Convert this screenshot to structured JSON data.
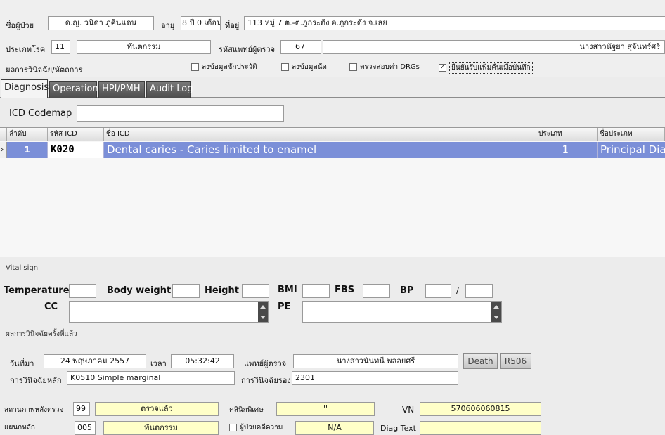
{
  "patient": {
    "name_label": "ชื่อผู้ป่วย",
    "name": "ด.ญ. วนิดา ภูคินแดน",
    "age_label": "อายุ",
    "age": "8 ปี 0 เดือน",
    "address_label": "ที่อยู่",
    "address": "113 หมู่ 7 ต.-ต.ภูกระดึง อ.ภูกระดึง จ.เลย",
    "disease_type_label": "ประเภทโรค",
    "disease_type_code": "11",
    "disease_type_name": "ทันตกรรม",
    "doctor_code_label": "รหัสแพทย์ผู้ตรวจ",
    "doctor_code": "67",
    "doctor_name": "นางสาวนัฐยา สุจันทร์ศรี",
    "result_label": "ผลการวินิจฉัย/หัตถการ"
  },
  "checkboxes": [
    {
      "label": "ลงข้อมูลซักประวัติ",
      "checked": false
    },
    {
      "label": "ลงข้อมูลนัด",
      "checked": false
    },
    {
      "label": "ตรวจสอบค่า DRGs",
      "checked": false
    },
    {
      "label": "ยืนยันรับแฟ้มคืนเมื่อบันทึก",
      "checked": true
    }
  ],
  "tabs": [
    "Diagnosis",
    "Operation",
    "HPI/PMH",
    "Audit Log"
  ],
  "icd_codemap": {
    "label": "ICD Codemap",
    "value": ""
  },
  "grid": {
    "columns": [
      "ลำดับ",
      "รหัส ICD",
      "ชื่อ ICD",
      "ประเภท",
      "ชื่อประเภท"
    ],
    "rows": [
      {
        "no": "1",
        "code": "K020",
        "name": "Dental caries - Caries limited to enamel",
        "type": "1",
        "type_name": "Principal Diag"
      }
    ]
  },
  "vital": {
    "section_label": "Vital sign",
    "temperature_label": "Temperature",
    "weight_label": "Body weight",
    "height_label": "Height",
    "bmi_label": "BMI",
    "fbs_label": "FBS",
    "bp_label": "BP",
    "bp_sep": "/",
    "cc_label": "CC",
    "pe_label": "PE"
  },
  "previous": {
    "section_label": "ผลการวินิจฉัยครั้งที่แล้ว",
    "date_label": "วันที่มา",
    "date": "24 พฤษภาคม 2557",
    "time_label": "เวลา",
    "time": "05:32:42",
    "doctor_label": "แพทย์ผู้ตรวจ",
    "doctor": "นางสาวนันทนี พลอยศรี",
    "death_button": "Death",
    "r506_button": "R506",
    "main_dx_label": "การวินิจฉัยหลัก",
    "main_dx": "K0510 Simple marginal",
    "sub_dx_label": "การวินิจฉัยรอง",
    "sub_dx": "2301"
  },
  "footer": {
    "status_label": "สถานภาพหลังตรวจ",
    "status_code": "99",
    "status_name": "ตรวจแล้ว",
    "clinic_label": "คลินิกพิเศษ",
    "clinic_value": "\"\"",
    "vn_label": "VN",
    "vn_value": "570606060815",
    "dept_label": "แผนกหลัก",
    "dept_code": "005",
    "dept_name": "ทันตกรรม",
    "sick_label": "ผู้ป่วยคดีความ",
    "sick_value": "N/A",
    "diag_text_label": "Diag Text"
  }
}
